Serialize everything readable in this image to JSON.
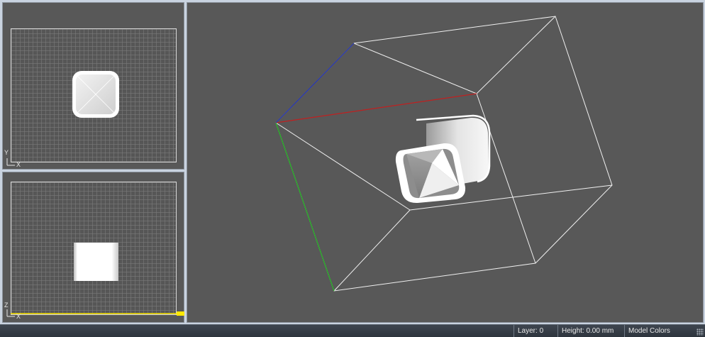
{
  "viewports": {
    "top": {
      "axis_labels": [
        "Y",
        "X"
      ]
    },
    "front": {
      "axis_labels": [
        "Z",
        "X"
      ]
    },
    "perspective": {}
  },
  "status_bar": {
    "layer": "Layer: 0",
    "height": "Height: 0.00 mm",
    "color_mode": "Model Colors"
  },
  "colors": {
    "background": "#585858",
    "grid_border": "#d8d8d8",
    "axis_x": "#c02020",
    "axis_y": "#20b020",
    "axis_z": "#2030b0",
    "build_volume": "#f0f0f0",
    "floor_highlight": "#ffe800",
    "status_bar": "#353c44"
  },
  "icons": [
    "axis-triad-icon",
    "resize-grip-icon"
  ]
}
